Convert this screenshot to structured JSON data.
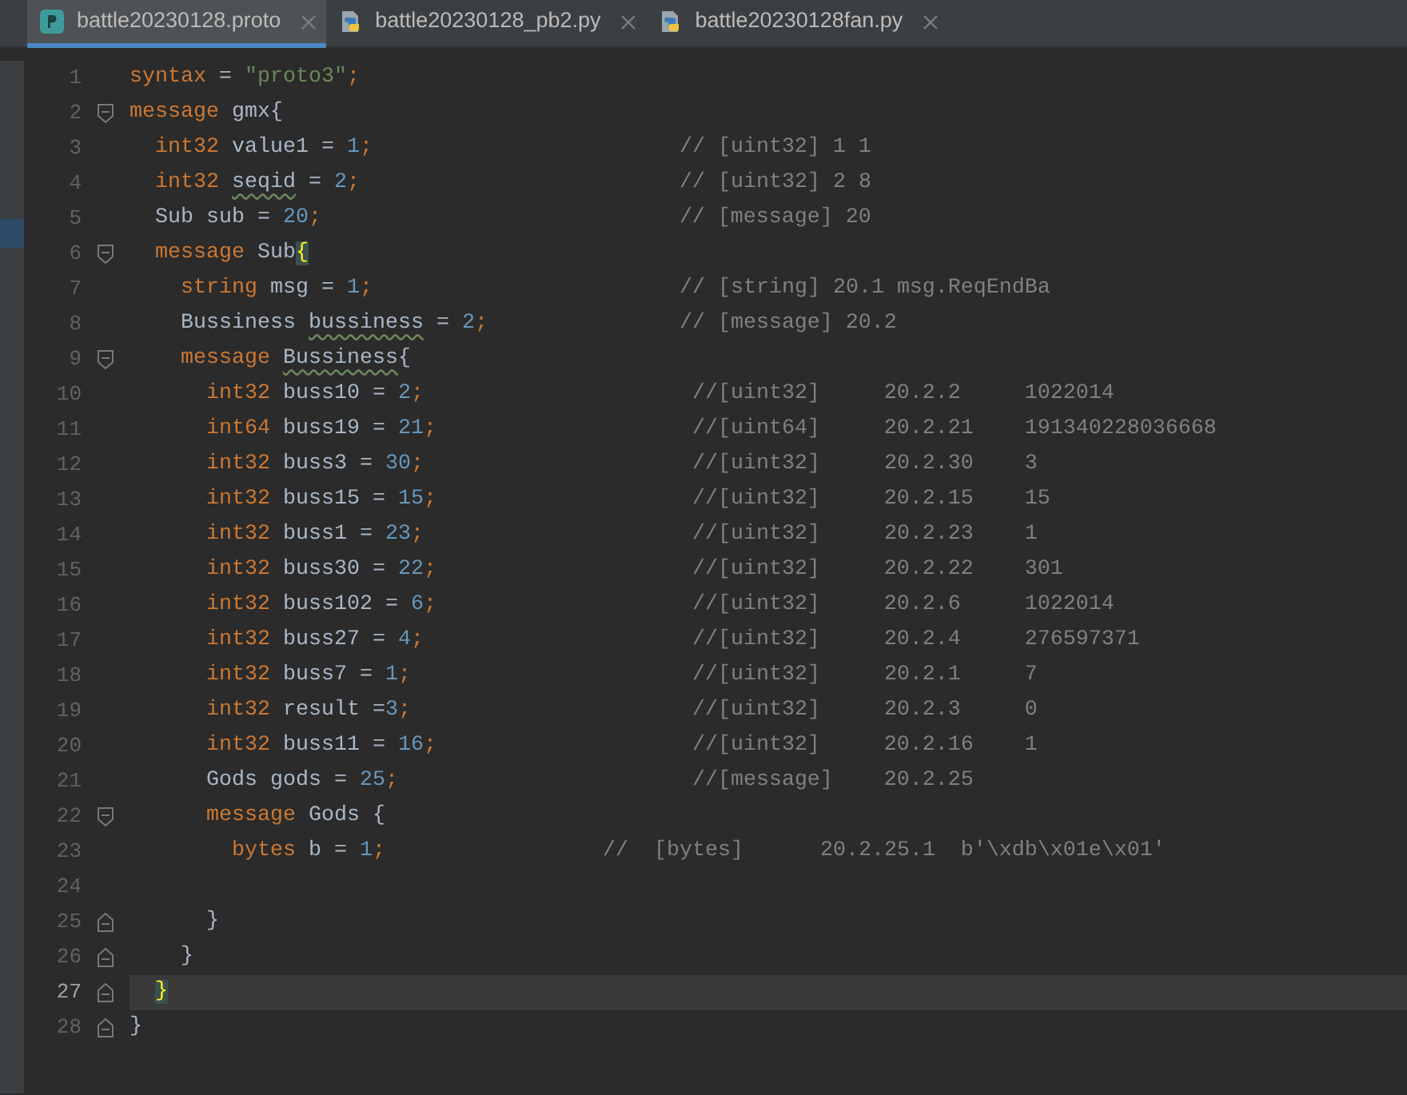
{
  "tabs": [
    {
      "label": "battle20230128.proto",
      "kind": "proto",
      "selected": true
    },
    {
      "label": "battle20230128_pb2.py",
      "kind": "python",
      "selected": false
    },
    {
      "label": "battle20230128fan.py",
      "kind": "python",
      "selected": false
    }
  ],
  "lines": [
    {
      "number": "1",
      "current": false,
      "fold_start": false,
      "fold_end": false,
      "tokens": [
        {
          "kind": "keyword",
          "text": "syntax"
        },
        {
          "kind": "ident",
          "text": " = "
        },
        {
          "kind": "string",
          "text": "\"proto3\""
        },
        {
          "kind": "keyword",
          "text": ";"
        }
      ]
    },
    {
      "number": "2",
      "current": false,
      "fold_start": true,
      "fold_end": false,
      "tokens": [
        {
          "kind": "keyword",
          "text": "message"
        },
        {
          "kind": "ident",
          "text": " gmx{"
        }
      ]
    },
    {
      "number": "3",
      "current": false,
      "fold_start": false,
      "fold_end": false,
      "tokens": [
        {
          "kind": "keyword",
          "text": "  int32"
        },
        {
          "kind": "ident",
          "text": " value1 = "
        },
        {
          "kind": "number",
          "text": "1"
        },
        {
          "kind": "keyword",
          "text": ";"
        },
        {
          "kind": "comment",
          "text": "                        // [uint32] 1 1"
        }
      ]
    },
    {
      "number": "4",
      "current": false,
      "fold_start": false,
      "fold_end": false,
      "tokens": [
        {
          "kind": "keyword",
          "text": "  int32"
        },
        {
          "kind": "warning",
          "text": " seqid"
        },
        {
          "kind": "ident",
          "text": " = "
        },
        {
          "kind": "number",
          "text": "2"
        },
        {
          "kind": "keyword",
          "text": ";"
        },
        {
          "kind": "comment",
          "text": "                         // [uint32] 2 8"
        }
      ]
    },
    {
      "number": "5",
      "current": false,
      "fold_start": false,
      "fold_end": false,
      "tokens": [
        {
          "kind": "ident",
          "text": "  Sub sub = "
        },
        {
          "kind": "number",
          "text": "20"
        },
        {
          "kind": "keyword",
          "text": ";"
        },
        {
          "kind": "comment",
          "text": "                            // [message] 20"
        }
      ]
    },
    {
      "number": "6",
      "current": false,
      "fold_start": true,
      "fold_end": false,
      "tokens": [
        {
          "kind": "keyword",
          "text": "  message"
        },
        {
          "kind": "ident",
          "text": " Sub"
        },
        {
          "kind": "brace_match",
          "text": "{"
        }
      ]
    },
    {
      "number": "7",
      "current": false,
      "fold_start": false,
      "fold_end": false,
      "tokens": [
        {
          "kind": "keyword",
          "text": "    string"
        },
        {
          "kind": "ident",
          "text": " msg = "
        },
        {
          "kind": "number",
          "text": "1"
        },
        {
          "kind": "keyword",
          "text": ";"
        },
        {
          "kind": "comment",
          "text": "                        // [string] 20.1 msg.ReqEndBa"
        }
      ]
    },
    {
      "number": "8",
      "current": false,
      "fold_start": false,
      "fold_end": false,
      "tokens": [
        {
          "kind": "ident",
          "text": "    Bussiness"
        },
        {
          "kind": "warning",
          "text": " bussiness"
        },
        {
          "kind": "ident",
          "text": " = "
        },
        {
          "kind": "number",
          "text": "2"
        },
        {
          "kind": "keyword",
          "text": ";"
        },
        {
          "kind": "comment",
          "text": "               // [message] 20.2"
        }
      ]
    },
    {
      "number": "9",
      "current": false,
      "fold_start": true,
      "fold_end": false,
      "tokens": [
        {
          "kind": "keyword",
          "text": "    message"
        },
        {
          "kind": "warning",
          "text": " Bussiness"
        },
        {
          "kind": "ident",
          "text": "{"
        }
      ]
    },
    {
      "number": "10",
      "current": false,
      "fold_start": false,
      "fold_end": false,
      "tokens": [
        {
          "kind": "keyword",
          "text": "      int32"
        },
        {
          "kind": "ident",
          "text": " buss10 = "
        },
        {
          "kind": "number",
          "text": "2"
        },
        {
          "kind": "keyword",
          "text": ";"
        },
        {
          "kind": "comment",
          "text": "                     //[uint32]     20.2.2     1022014"
        }
      ]
    },
    {
      "number": "11",
      "current": false,
      "fold_start": false,
      "fold_end": false,
      "tokens": [
        {
          "kind": "keyword",
          "text": "      int64"
        },
        {
          "kind": "ident",
          "text": " buss19 = "
        },
        {
          "kind": "number",
          "text": "21"
        },
        {
          "kind": "keyword",
          "text": ";"
        },
        {
          "kind": "comment",
          "text": "                    //[uint64]     20.2.21    191340228036668"
        }
      ]
    },
    {
      "number": "12",
      "current": false,
      "fold_start": false,
      "fold_end": false,
      "tokens": [
        {
          "kind": "keyword",
          "text": "      int32"
        },
        {
          "kind": "ident",
          "text": " buss3 = "
        },
        {
          "kind": "number",
          "text": "30"
        },
        {
          "kind": "keyword",
          "text": ";"
        },
        {
          "kind": "comment",
          "text": "                     //[uint32]     20.2.30    3"
        }
      ]
    },
    {
      "number": "13",
      "current": false,
      "fold_start": false,
      "fold_end": false,
      "tokens": [
        {
          "kind": "keyword",
          "text": "      int32"
        },
        {
          "kind": "ident",
          "text": " buss15 = "
        },
        {
          "kind": "number",
          "text": "15"
        },
        {
          "kind": "keyword",
          "text": ";"
        },
        {
          "kind": "comment",
          "text": "                    //[uint32]     20.2.15    15"
        }
      ]
    },
    {
      "number": "14",
      "current": false,
      "fold_start": false,
      "fold_end": false,
      "tokens": [
        {
          "kind": "keyword",
          "text": "      int32"
        },
        {
          "kind": "ident",
          "text": " buss1 = "
        },
        {
          "kind": "number",
          "text": "23"
        },
        {
          "kind": "keyword",
          "text": ";"
        },
        {
          "kind": "comment",
          "text": "                     //[uint32]     20.2.23    1"
        }
      ]
    },
    {
      "number": "15",
      "current": false,
      "fold_start": false,
      "fold_end": false,
      "tokens": [
        {
          "kind": "keyword",
          "text": "      int32"
        },
        {
          "kind": "ident",
          "text": " buss30 = "
        },
        {
          "kind": "number",
          "text": "22"
        },
        {
          "kind": "keyword",
          "text": ";"
        },
        {
          "kind": "comment",
          "text": "                    //[uint32]     20.2.22    301"
        }
      ]
    },
    {
      "number": "16",
      "current": false,
      "fold_start": false,
      "fold_end": false,
      "tokens": [
        {
          "kind": "keyword",
          "text": "      int32"
        },
        {
          "kind": "ident",
          "text": " buss102 = "
        },
        {
          "kind": "number",
          "text": "6"
        },
        {
          "kind": "keyword",
          "text": ";"
        },
        {
          "kind": "comment",
          "text": "                    //[uint32]     20.2.6     1022014"
        }
      ]
    },
    {
      "number": "17",
      "current": false,
      "fold_start": false,
      "fold_end": false,
      "tokens": [
        {
          "kind": "keyword",
          "text": "      int32"
        },
        {
          "kind": "ident",
          "text": " buss27 = "
        },
        {
          "kind": "number",
          "text": "4"
        },
        {
          "kind": "keyword",
          "text": ";"
        },
        {
          "kind": "comment",
          "text": "                     //[uint32]     20.2.4     276597371"
        }
      ]
    },
    {
      "number": "18",
      "current": false,
      "fold_start": false,
      "fold_end": false,
      "tokens": [
        {
          "kind": "keyword",
          "text": "      int32"
        },
        {
          "kind": "ident",
          "text": " buss7 = "
        },
        {
          "kind": "number",
          "text": "1"
        },
        {
          "kind": "keyword",
          "text": ";"
        },
        {
          "kind": "comment",
          "text": "                      //[uint32]     20.2.1     7"
        }
      ]
    },
    {
      "number": "19",
      "current": false,
      "fold_start": false,
      "fold_end": false,
      "tokens": [
        {
          "kind": "keyword",
          "text": "      int32"
        },
        {
          "kind": "ident",
          "text": " result ="
        },
        {
          "kind": "number",
          "text": "3"
        },
        {
          "kind": "keyword",
          "text": ";"
        },
        {
          "kind": "comment",
          "text": "                      //[uint32]     20.2.3     0"
        }
      ]
    },
    {
      "number": "20",
      "current": false,
      "fold_start": false,
      "fold_end": false,
      "tokens": [
        {
          "kind": "keyword",
          "text": "      int32"
        },
        {
          "kind": "ident",
          "text": " buss11 = "
        },
        {
          "kind": "number",
          "text": "16"
        },
        {
          "kind": "keyword",
          "text": ";"
        },
        {
          "kind": "comment",
          "text": "                    //[uint32]     20.2.16    1"
        }
      ]
    },
    {
      "number": "21",
      "current": false,
      "fold_start": false,
      "fold_end": false,
      "tokens": [
        {
          "kind": "ident",
          "text": "      Gods gods = "
        },
        {
          "kind": "number",
          "text": "25"
        },
        {
          "kind": "keyword",
          "text": ";"
        },
        {
          "kind": "comment",
          "text": "                       //[message]    20.2.25"
        }
      ]
    },
    {
      "number": "22",
      "current": false,
      "fold_start": true,
      "fold_end": false,
      "tokens": [
        {
          "kind": "keyword",
          "text": "      message"
        },
        {
          "kind": "ident",
          "text": " Gods {"
        }
      ]
    },
    {
      "number": "23",
      "current": false,
      "fold_start": false,
      "fold_end": false,
      "tokens": [
        {
          "kind": "keyword",
          "text": "        bytes"
        },
        {
          "kind": "ident",
          "text": " b = "
        },
        {
          "kind": "number",
          "text": "1"
        },
        {
          "kind": "keyword",
          "text": ";"
        },
        {
          "kind": "comment",
          "text": "                 //  [bytes]      20.2.25.1  b'\\xdb\\x01e\\x01'"
        }
      ]
    },
    {
      "number": "24",
      "current": false,
      "fold_start": false,
      "fold_end": false
    },
    {
      "number": "25",
      "current": false,
      "fold_start": false,
      "fold_end": true,
      "tokens": [
        {
          "kind": "ident",
          "text": "      }"
        }
      ]
    },
    {
      "number": "26",
      "current": false,
      "fold_start": false,
      "fold_end": true,
      "tokens": [
        {
          "kind": "ident",
          "text": "    }"
        }
      ]
    },
    {
      "number": "27",
      "current": true,
      "fold_start": false,
      "fold_end": true,
      "tokens": [
        {
          "kind": "brace_match",
          "text": "  }"
        }
      ]
    },
    {
      "number": "28",
      "current": false,
      "fold_start": false,
      "fold_end": true,
      "tokens": [
        {
          "kind": "ident",
          "text": "}"
        }
      ]
    }
  ]
}
